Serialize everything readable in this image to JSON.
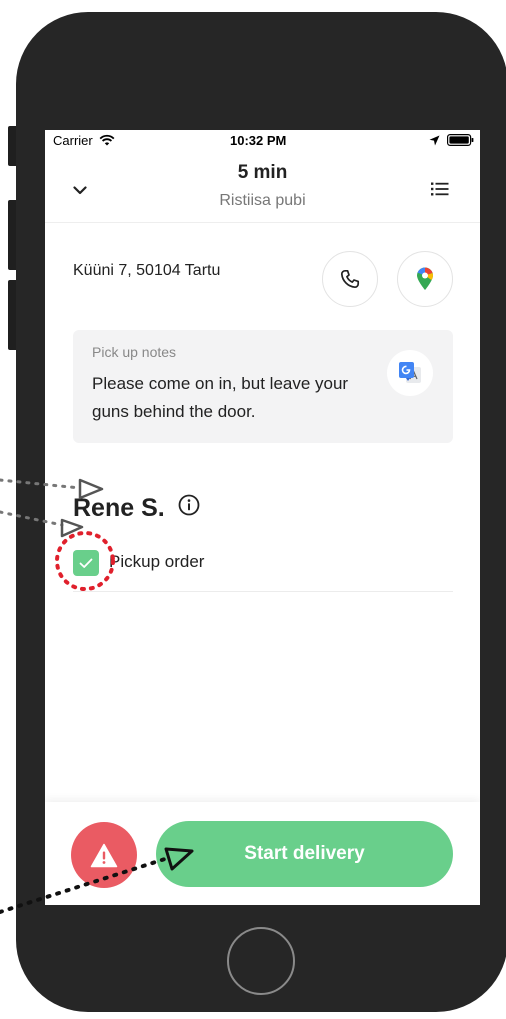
{
  "status_bar": {
    "carrier": "Carrier",
    "time": "10:32 PM"
  },
  "header": {
    "eta": "5 min",
    "place": "Ristiisa pubi"
  },
  "address": {
    "text": "Küüni 7, 50104 Tartu"
  },
  "notes": {
    "label": "Pick up notes",
    "text": "Please come on in, but leave your guns behind the door."
  },
  "customer": {
    "name": "Rene S."
  },
  "pickup": {
    "label": "Pickup order",
    "checked": true
  },
  "footer": {
    "start_label": "Start delivery"
  },
  "colors": {
    "accent_green": "#69cf8b",
    "alert_red": "#ea5b63",
    "phone_frame": "#262626",
    "annotation_red": "#e0202c"
  },
  "icons": {
    "signal": "wifi-icon",
    "location": "location-arrow-icon",
    "battery": "battery-icon",
    "collapse": "chevron-down-icon",
    "menu": "list-icon",
    "call": "phone-icon",
    "map": "map-pin-icon",
    "translate": "translate-icon",
    "info": "info-icon",
    "check": "check-icon",
    "alert": "warning-icon"
  }
}
